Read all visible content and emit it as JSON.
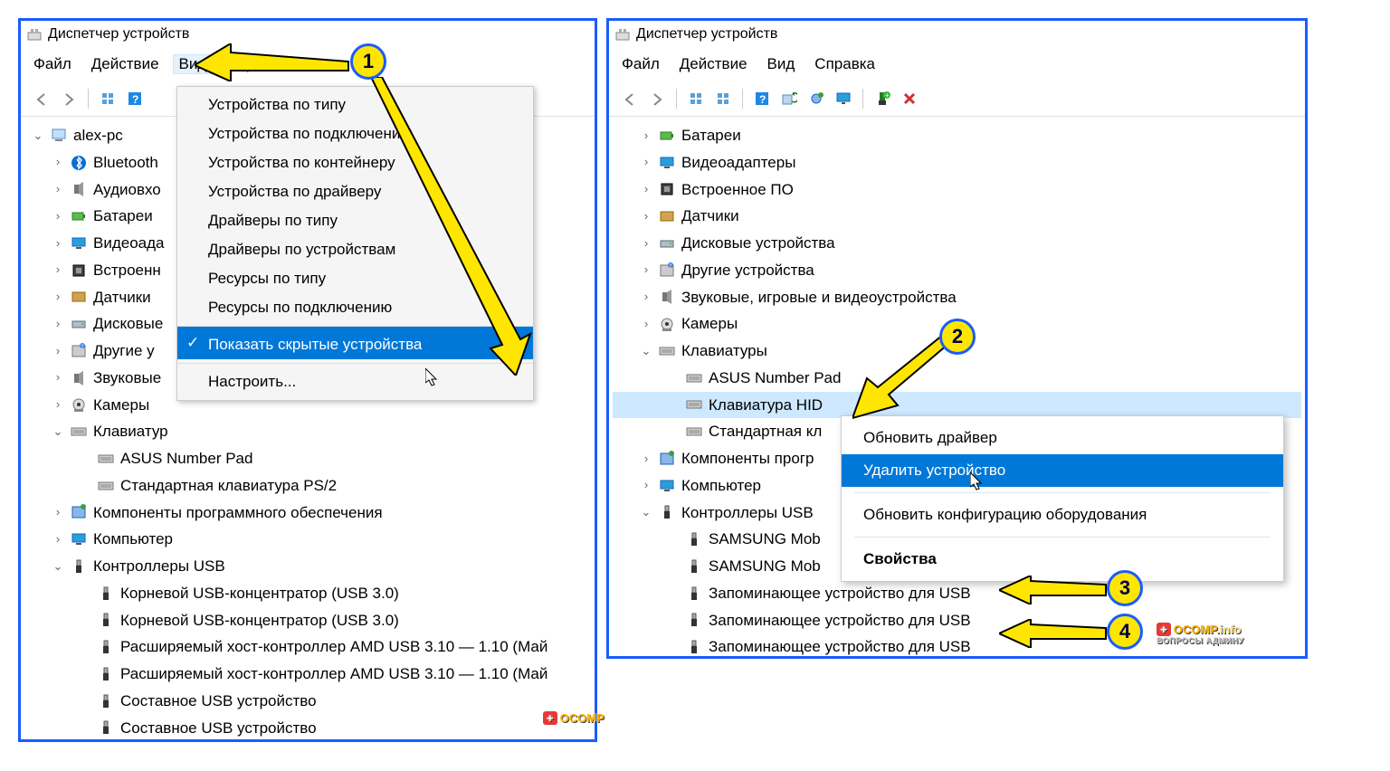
{
  "window_title": "Диспетчер устройств",
  "menus": {
    "file": "Файл",
    "action": "Действие",
    "view": "Вид",
    "help": "Справка"
  },
  "view_menu": {
    "by_type": "Устройства по типу",
    "by_conn": "Устройства по подключению",
    "by_cont": "Устройства по контейнеру",
    "by_drv": "Устройства по драйверу",
    "drv_type": "Драйверы по типу",
    "drv_dev": "Драйверы по устройствам",
    "res_type": "Ресурсы по типу",
    "res_conn": "Ресурсы по подключению",
    "show_hidden": "Показать скрытые устройства",
    "customize": "Настроить..."
  },
  "root": "alex-pc",
  "left_tree": {
    "bluetooth": "Bluetooth",
    "audio_in": "Аудиовхо",
    "battery": "Батареи",
    "video": "Видеоада",
    "fw": "Встроенн",
    "sensors": "Датчики",
    "disks": "Дисковые",
    "other": "Другие у",
    "sound": "Звуковые",
    "cameras": "Камеры",
    "keyboards": "Клавиатур",
    "kb1": "ASUS Number Pad",
    "kb2": "Стандартная клавиатура PS/2",
    "sw": "Компоненты программного обеспечения",
    "computer": "Компьютер",
    "usbctrl": "Контроллеры USB",
    "usb1": "Корневой USB-концентратор (USB 3.0)",
    "usb2": "Корневой USB-концентратор (USB 3.0)",
    "usb3": "Расширяемый хост-контроллер AMD USB 3.10 — 1.10 (Май",
    "usb4": "Расширяемый хост-контроллер AMD USB 3.10 — 1.10 (Май",
    "usb5": "Составное USB устройство",
    "usb6": "Составное USB устройство"
  },
  "right_tree": {
    "battery": "Батареи",
    "video": "Видеоадаптеры",
    "fw": "Встроенное ПО",
    "sensors": "Датчики",
    "disks": "Дисковые устройства",
    "other": "Другие устройства",
    "sound": "Звуковые, игровые и видеоустройства",
    "cameras": "Камеры",
    "keyboards": "Клавиатуры",
    "kb1": "ASUS Number Pad",
    "kb2": "Клавиатура HID",
    "kb3": "Стандартная кл",
    "sw": "Компоненты прогр",
    "computer": "Компьютер",
    "usbctrl": "Контроллеры USB",
    "u1": "SAMSUNG Mob",
    "u2": "SAMSUNG Mob",
    "u3": "Запоминающее устройство для USB",
    "u4": "Запоминающее устройство для USB",
    "u5": "Запоминающее устройство для USB"
  },
  "ctx": {
    "update": "Обновить драйвер",
    "delete": "Удалить устройство",
    "rescan": "Обновить конфигурацию оборудования",
    "props": "Свойства"
  },
  "markers": {
    "m1": "1",
    "m2": "2",
    "m3": "3",
    "m4": "4"
  },
  "watermark": {
    "plus": "+",
    "text1": "OCOMP",
    "text2": ".info",
    "sub": "ВОПРОСЫ АДМИНУ"
  }
}
